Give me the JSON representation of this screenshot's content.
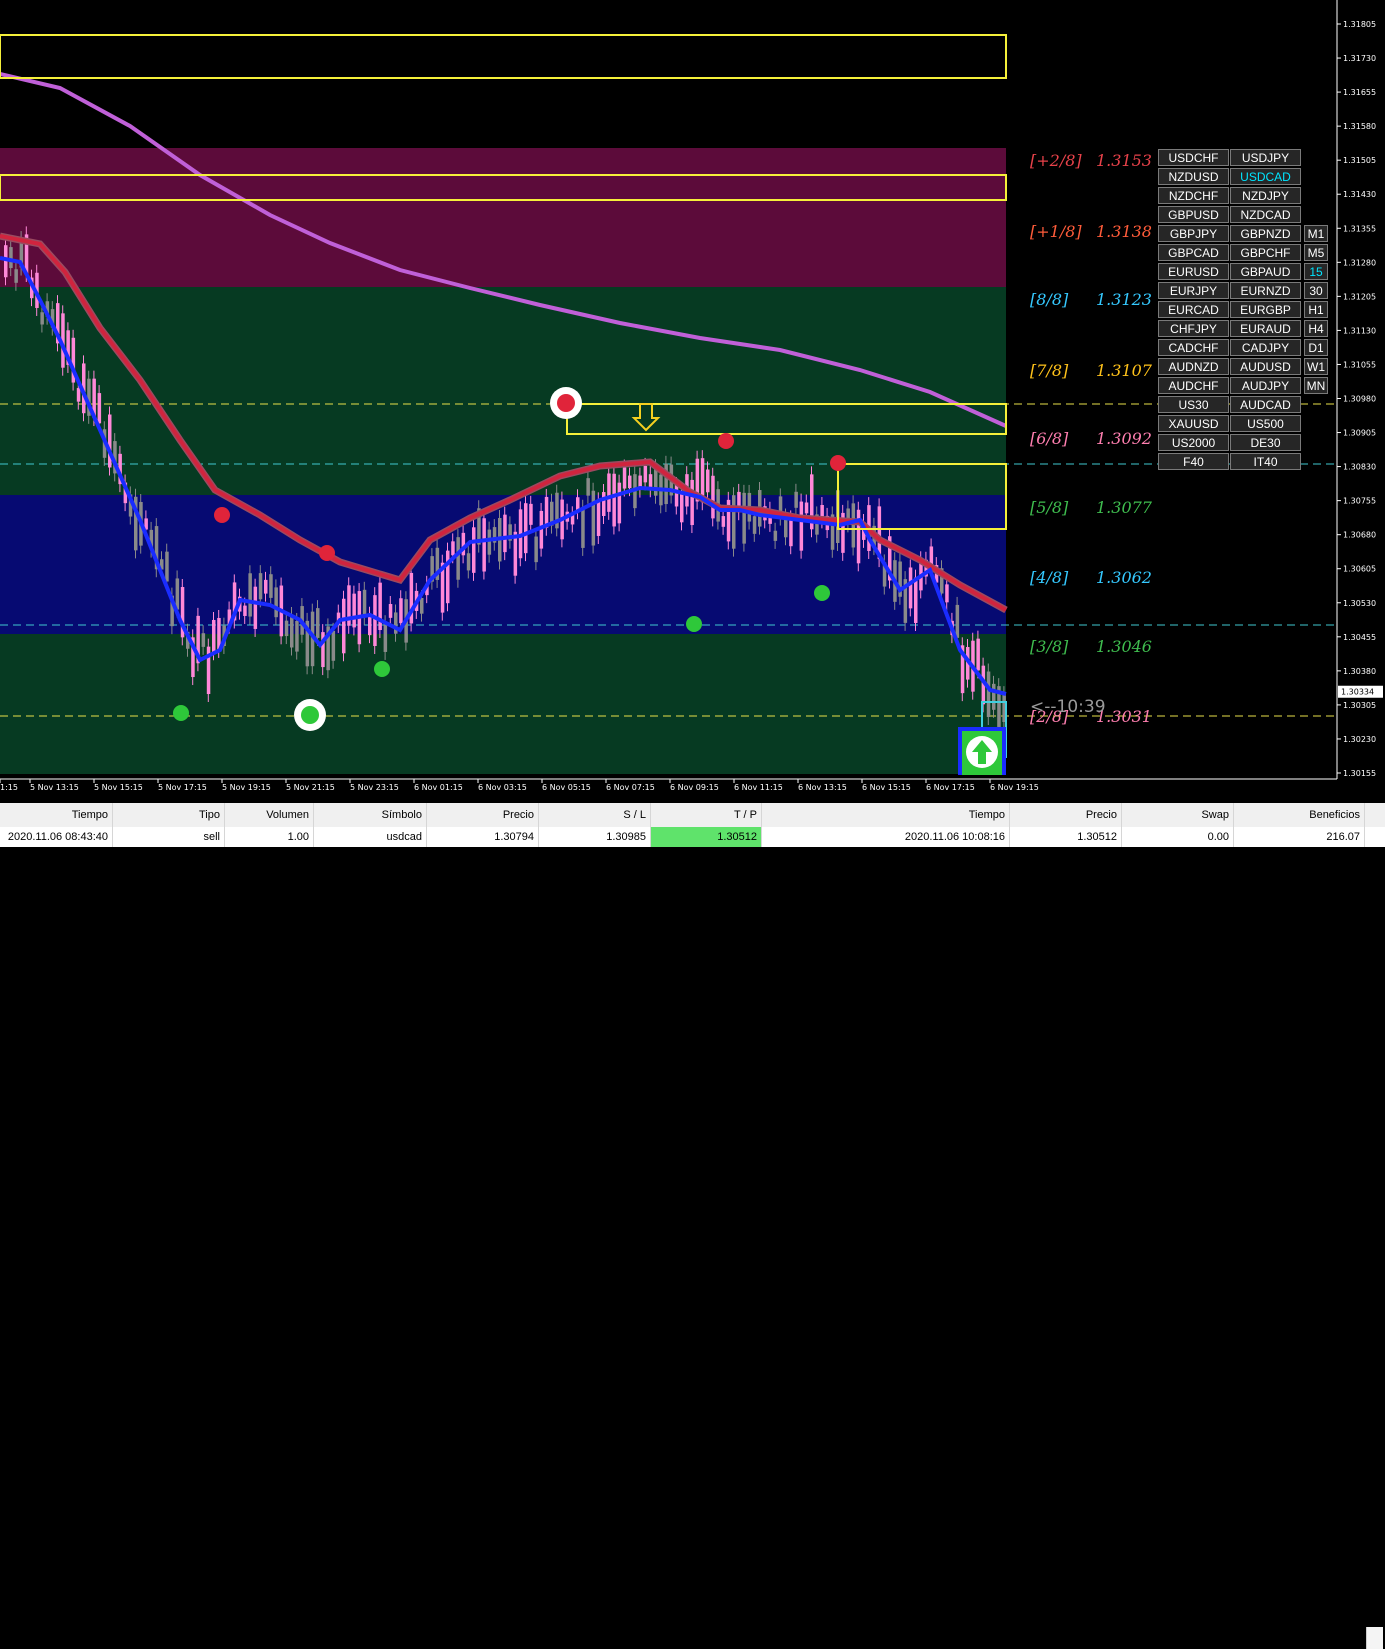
{
  "chart": {
    "symbol": "USDCAD",
    "timeframe": "15",
    "price_axis": [
      "1.31805",
      "1.31730",
      "1.31655",
      "1.31580",
      "1.31505",
      "1.31430",
      "1.31355",
      "1.31280",
      "1.31205",
      "1.31130",
      "1.31055",
      "1.30980",
      "1.30905",
      "1.30830",
      "1.30755",
      "1.30680",
      "1.30605",
      "1.30530",
      "1.30455",
      "1.30380",
      "1.30305",
      "1.30230",
      "1.30155"
    ],
    "current_price": "1.30334",
    "countdown": "<--10:39",
    "time_axis": [
      "1:15",
      "5 Nov 13:15",
      "5 Nov 15:15",
      "5 Nov 17:15",
      "5 Nov 19:15",
      "5 Nov 21:15",
      "5 Nov 23:15",
      "6 Nov 01:15",
      "6 Nov 03:15",
      "6 Nov 05:15",
      "6 Nov 07:15",
      "6 Nov 09:15",
      "6 Nov 11:15",
      "6 Nov 13:15",
      "6 Nov 15:15",
      "6 Nov 17:15",
      "6 Nov 19:15"
    ],
    "murrey_levels": [
      {
        "label": "[+2/8]",
        "value": "1.3153",
        "color": "#e8424a"
      },
      {
        "label": "[+1/8]",
        "value": "1.3138",
        "color": "#ff5c3a"
      },
      {
        "label": "[8/8]",
        "value": "1.3123",
        "color": "#35c9ff"
      },
      {
        "label": "[7/8]",
        "value": "1.3107",
        "color": "#ffc21a"
      },
      {
        "label": "[6/8]",
        "value": "1.3092",
        "color": "#ff7fb0"
      },
      {
        "label": "[5/8]",
        "value": "1.3077",
        "color": "#3fbd4f"
      },
      {
        "label": "[4/8]",
        "value": "1.3062",
        "color": "#35c9ff"
      },
      {
        "label": "[3/8]",
        "value": "1.3046",
        "color": "#3fbd4f"
      },
      {
        "label": "[2/8]",
        "value": "1.3031",
        "color": "#ff7fb0"
      }
    ],
    "colors": {
      "maroon_zone": "#5c0b3a",
      "green_zone": "#063a22",
      "blue_zone": "#060a72",
      "sma_purple": "#c060d8",
      "ema_red": "#d0243e",
      "ema_blue": "#1a2cff",
      "zone_box": "#f5f03a",
      "bull_candle": "#8a8a8a",
      "bear_candle": "#ff88d8",
      "signal_red": "#e0243a",
      "signal_green": "#2ec83a"
    }
  },
  "symbol_buttons": [
    [
      "USDCHF",
      "USDJPY"
    ],
    [
      "NZDUSD",
      "USDCAD"
    ],
    [
      "NZDCHF",
      "NZDJPY"
    ],
    [
      "GBPUSD",
      "NZDCAD"
    ],
    [
      "GBPJPY",
      "GBPNZD"
    ],
    [
      "GBPCAD",
      "GBPCHF"
    ],
    [
      "EURUSD",
      "GBPAUD"
    ],
    [
      "EURJPY",
      "EURNZD"
    ],
    [
      "EURCAD",
      "EURGBP"
    ],
    [
      "CHFJPY",
      "EURAUD"
    ],
    [
      "CADCHF",
      "CADJPY"
    ],
    [
      "AUDNZD",
      "AUDUSD"
    ],
    [
      "AUDCHF",
      "AUDJPY"
    ],
    [
      "US30",
      "AUDCAD"
    ],
    [
      "XAUUSD",
      "US500"
    ],
    [
      "US2000",
      "DE30"
    ],
    [
      "F40",
      "IT40"
    ]
  ],
  "timeframe_buttons": [
    "M1",
    "M5",
    "15",
    "30",
    "H1",
    "H4",
    "D1",
    "W1",
    "MN"
  ],
  "trade_table": {
    "headers": {
      "time_open": "Tiempo",
      "type": "Tipo",
      "volume": "Volumen",
      "symbol": "Símbolo",
      "price_open": "Precio",
      "sl": "S / L",
      "tp": "T / P",
      "time_close": "Tiempo",
      "price_close": "Precio",
      "swap": "Swap",
      "profit": "Beneficios"
    },
    "row": {
      "time_open": "2020.11.06 08:43:40",
      "type": "sell",
      "volume": "1.00",
      "symbol": "usdcad",
      "price_open": "1.30794",
      "sl": "1.30985",
      "tp": "1.30512",
      "time_close": "2020.11.06 10:08:16",
      "price_close": "1.30512",
      "swap": "0.00",
      "profit": "216.07"
    }
  }
}
